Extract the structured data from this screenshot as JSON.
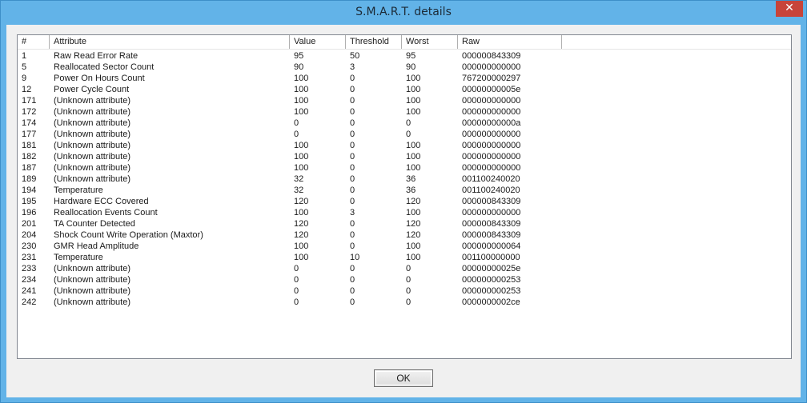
{
  "window": {
    "title": "S.M.A.R.T. details",
    "close_glyph": "✕"
  },
  "table": {
    "columns": [
      "#",
      "Attribute",
      "Value",
      "Threshold",
      "Worst",
      "Raw"
    ],
    "rows": [
      [
        "1",
        "Raw Read Error Rate",
        "95",
        "50",
        "95",
        "000000843309"
      ],
      [
        "5",
        "Reallocated Sector Count",
        "90",
        "3",
        "90",
        "000000000000"
      ],
      [
        "9",
        "Power On Hours Count",
        "100",
        "0",
        "100",
        "767200000297"
      ],
      [
        "12",
        "Power Cycle Count",
        "100",
        "0",
        "100",
        "00000000005e"
      ],
      [
        "171",
        "(Unknown attribute)",
        "100",
        "0",
        "100",
        "000000000000"
      ],
      [
        "172",
        "(Unknown attribute)",
        "100",
        "0",
        "100",
        "000000000000"
      ],
      [
        "174",
        "(Unknown attribute)",
        "0",
        "0",
        "0",
        "00000000000a"
      ],
      [
        "177",
        "(Unknown attribute)",
        "0",
        "0",
        "0",
        "000000000000"
      ],
      [
        "181",
        "(Unknown attribute)",
        "100",
        "0",
        "100",
        "000000000000"
      ],
      [
        "182",
        "(Unknown attribute)",
        "100",
        "0",
        "100",
        "000000000000"
      ],
      [
        "187",
        "(Unknown attribute)",
        "100",
        "0",
        "100",
        "000000000000"
      ],
      [
        "189",
        "(Unknown attribute)",
        "32",
        "0",
        "36",
        "001100240020"
      ],
      [
        "194",
        "Temperature",
        "32",
        "0",
        "36",
        "001100240020"
      ],
      [
        "195",
        "Hardware ECC Covered",
        "120",
        "0",
        "120",
        "000000843309"
      ],
      [
        "196",
        "Reallocation Events Count",
        "100",
        "3",
        "100",
        "000000000000"
      ],
      [
        "201",
        "TA Counter Detected",
        "120",
        "0",
        "120",
        "000000843309"
      ],
      [
        "204",
        "Shock Count Write Operation (Maxtor)",
        "120",
        "0",
        "120",
        "000000843309"
      ],
      [
        "230",
        "GMR Head Amplitude",
        "100",
        "0",
        "100",
        "000000000064"
      ],
      [
        "231",
        "Temperature",
        "100",
        "10",
        "100",
        "001100000000"
      ],
      [
        "233",
        "(Unknown attribute)",
        "0",
        "0",
        "0",
        "00000000025e"
      ],
      [
        "234",
        "(Unknown attribute)",
        "0",
        "0",
        "0",
        "000000000253"
      ],
      [
        "241",
        "(Unknown attribute)",
        "0",
        "0",
        "0",
        "000000000253"
      ],
      [
        "242",
        "(Unknown attribute)",
        "0",
        "0",
        "0",
        "0000000002ce"
      ]
    ]
  },
  "buttons": {
    "ok_label": "OK"
  },
  "colors": {
    "titlebar": "#62b3e8",
    "close_button": "#c7443a",
    "client_background": "#f0f0f0"
  }
}
